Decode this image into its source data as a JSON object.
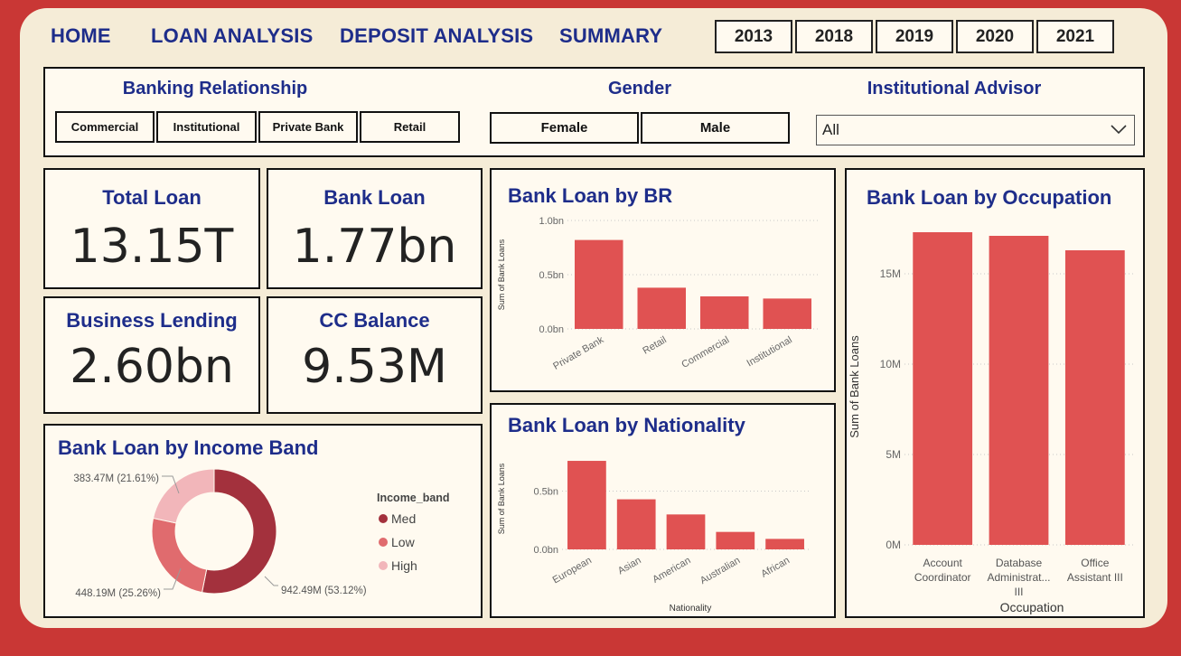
{
  "nav": {
    "home": "HOME",
    "loan_analysis": "LOAN ANALYSIS",
    "deposit_analysis": "DEPOSIT ANALYSIS",
    "summary": "SUMMARY"
  },
  "years": [
    "2013",
    "2018",
    "2019",
    "2020",
    "2021"
  ],
  "slicers": {
    "banking_relationship": {
      "title": "Banking Relationship",
      "options": [
        "Commercial",
        "Institutional",
        "Private Bank",
        "Retail"
      ]
    },
    "gender": {
      "title": "Gender",
      "options": [
        "Female",
        "Male"
      ]
    },
    "advisor": {
      "title": "Institutional Advisor",
      "value": "All"
    }
  },
  "kpis": {
    "total_loan": {
      "label": "Total Loan",
      "value": "13.15T"
    },
    "bank_loan": {
      "label": "Bank Loan",
      "value": "1.77bn"
    },
    "business_lending": {
      "label": "Business Lending",
      "value": "2.60bn"
    },
    "cc_balance": {
      "label": "CC Balance",
      "value": "9.53M"
    }
  },
  "colors": {
    "bar": "#e05252",
    "pie_med": "#a3313d",
    "pie_low": "#e06b6e",
    "pie_high": "#f2b6ba",
    "title": "#1e2d8a",
    "frame": "#c93735"
  },
  "icons": {
    "dropdown": "chevron-down-icon"
  },
  "chart_data": [
    {
      "id": "br",
      "type": "bar",
      "title": "Bank Loan by BR",
      "xlabel": "",
      "ylabel": "Sum of Bank Loans",
      "categories": [
        "Private Bank",
        "Retail",
        "Commercial",
        "Institutional"
      ],
      "values": [
        0.82,
        0.38,
        0.3,
        0.28
      ],
      "ylim": [
        0,
        1.0
      ],
      "ticks": [
        {
          "v": 0,
          "label": "0.0bn"
        },
        {
          "v": 0.5,
          "label": "0.5bn"
        },
        {
          "v": 1.0,
          "label": "1.0bn"
        }
      ],
      "grid": true
    },
    {
      "id": "nat",
      "type": "bar",
      "title": "Bank Loan by Nationality",
      "xlabel": "Nationality",
      "ylabel": "Sum of Bank Loans",
      "categories": [
        "European",
        "Asian",
        "American",
        "Australian",
        "African"
      ],
      "values": [
        0.76,
        0.43,
        0.3,
        0.15,
        0.09
      ],
      "ylim": [
        0,
        0.9
      ],
      "ticks": [
        {
          "v": 0,
          "label": "0.0bn"
        },
        {
          "v": 0.5,
          "label": "0.5bn"
        }
      ],
      "grid": true
    },
    {
      "id": "occ",
      "type": "bar",
      "title": "Bank Loan by Occupation",
      "xlabel": "Occupation",
      "ylabel": "Sum of Bank Loans",
      "categories": [
        [
          "Account",
          "Coordinator"
        ],
        [
          "Database",
          "Administrat...",
          "III"
        ],
        [
          "Office",
          "Assistant III"
        ]
      ],
      "values": [
        17.3,
        17.1,
        16.3
      ],
      "ylim": [
        0,
        20
      ],
      "ticks": [
        {
          "v": 0,
          "label": "0M"
        },
        {
          "v": 5,
          "label": "5M"
        },
        {
          "v": 10,
          "label": "10M"
        },
        {
          "v": 15,
          "label": "15M"
        }
      ],
      "grid": true
    },
    {
      "id": "income",
      "type": "pie",
      "title": "Bank Loan by Income Band",
      "legend_title": "Income_band",
      "slices": [
        {
          "name": "Med",
          "value": 942.49,
          "label": "942.49M (53.12%)"
        },
        {
          "name": "Low",
          "value": 448.19,
          "label": "448.19M (25.26%)"
        },
        {
          "name": "High",
          "value": 383.47,
          "label": "383.47M (21.61%)"
        }
      ]
    }
  ]
}
